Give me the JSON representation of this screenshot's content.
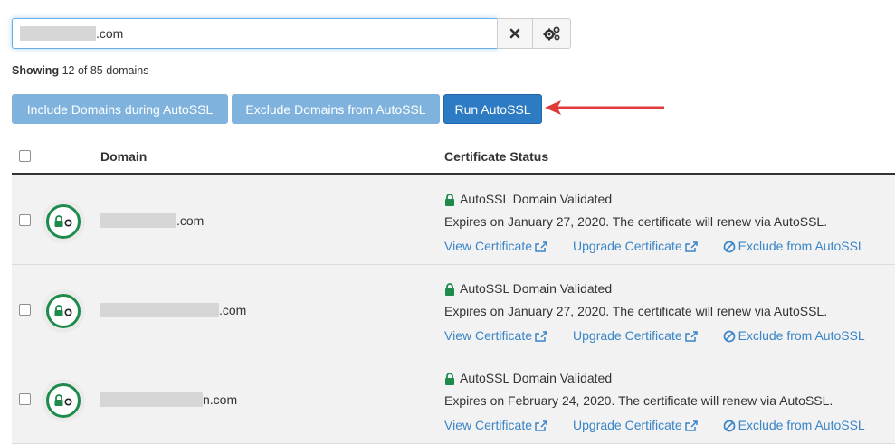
{
  "search": {
    "value_suffix": ".com"
  },
  "showing": {
    "label": "Showing",
    "text": "12 of 85 domains"
  },
  "actions": {
    "include_label": "Include Domains during AutoSSL",
    "exclude_label": "Exclude Domains from AutoSSL",
    "run_label": "Run AutoSSL"
  },
  "table": {
    "headers": {
      "domain": "Domain",
      "status": "Certificate Status"
    },
    "rows": [
      {
        "domain_suffix": ".com",
        "status_title": "AutoSSL Domain Validated",
        "expiry": "Expires on January 27, 2020. The certificate will renew via AutoSSL.",
        "view_link": "View Certificate",
        "upgrade_link": "Upgrade Certificate",
        "exclude_link": "Exclude from AutoSSL"
      },
      {
        "domain_suffix": ".com",
        "status_title": "AutoSSL Domain Validated",
        "expiry": "Expires on January 27, 2020. The certificate will renew via AutoSSL.",
        "view_link": "View Certificate",
        "upgrade_link": "Upgrade Certificate",
        "exclude_link": "Exclude from AutoSSL"
      },
      {
        "domain_suffix": "n.com",
        "status_title": "AutoSSL Domain Validated",
        "expiry": "Expires on February 24, 2020. The certificate will renew via AutoSSL.",
        "view_link": "View Certificate",
        "upgrade_link": "Upgrade Certificate",
        "exclude_link": "Exclude from AutoSSL"
      }
    ]
  },
  "colors": {
    "accent": "#2d7bc3",
    "link": "#3a85c7",
    "validated": "#1e8a4c",
    "arrow": "#e03a3a"
  },
  "icons": [
    "times-icon",
    "gears-icon",
    "lock-icon",
    "external-link-icon",
    "ban-icon",
    "arrow-left-icon"
  ]
}
